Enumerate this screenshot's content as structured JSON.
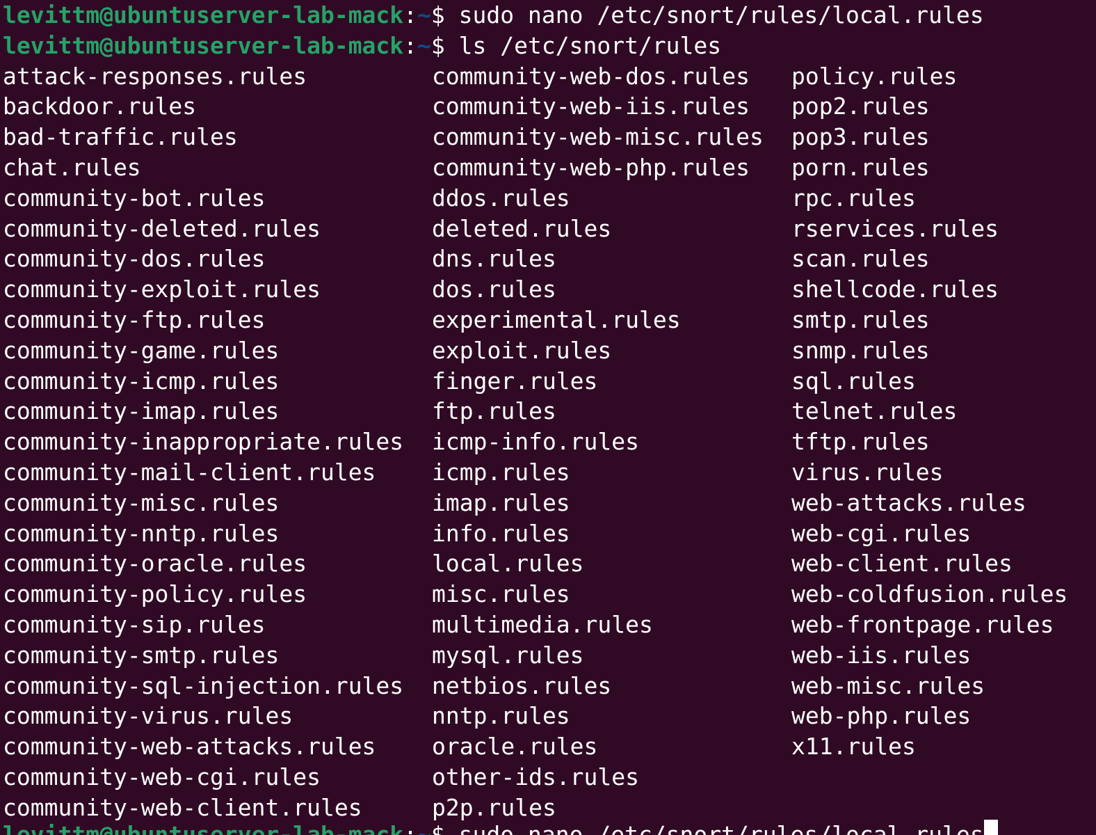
{
  "prompt": {
    "user_host": "levittm@ubuntuserver-lab-mack",
    "colon": ":",
    "path": "~",
    "dollar": "$ "
  },
  "history": [
    {
      "command": "sudo nano /etc/snort/rules/local.rules"
    },
    {
      "command": "ls /etc/snort/rules"
    }
  ],
  "listing": {
    "col1": [
      "attack-responses.rules",
      "backdoor.rules",
      "bad-traffic.rules",
      "chat.rules",
      "community-bot.rules",
      "community-deleted.rules",
      "community-dos.rules",
      "community-exploit.rules",
      "community-ftp.rules",
      "community-game.rules",
      "community-icmp.rules",
      "community-imap.rules",
      "community-inappropriate.rules",
      "community-mail-client.rules",
      "community-misc.rules",
      "community-nntp.rules",
      "community-oracle.rules",
      "community-policy.rules",
      "community-sip.rules",
      "community-smtp.rules",
      "community-sql-injection.rules",
      "community-virus.rules",
      "community-web-attacks.rules",
      "community-web-cgi.rules",
      "community-web-client.rules"
    ],
    "col2": [
      "community-web-dos.rules",
      "community-web-iis.rules",
      "community-web-misc.rules",
      "community-web-php.rules",
      "ddos.rules",
      "deleted.rules",
      "dns.rules",
      "dos.rules",
      "experimental.rules",
      "exploit.rules",
      "finger.rules",
      "ftp.rules",
      "icmp-info.rules",
      "icmp.rules",
      "imap.rules",
      "info.rules",
      "local.rules",
      "misc.rules",
      "multimedia.rules",
      "mysql.rules",
      "netbios.rules",
      "nntp.rules",
      "oracle.rules",
      "other-ids.rules",
      "p2p.rules"
    ],
    "col3": [
      "policy.rules",
      "pop2.rules",
      "pop3.rules",
      "porn.rules",
      "rpc.rules",
      "rservices.rules",
      "scan.rules",
      "shellcode.rules",
      "smtp.rules",
      "snmp.rules",
      "sql.rules",
      "telnet.rules",
      "tftp.rules",
      "virus.rules",
      "web-attacks.rules",
      "web-cgi.rules",
      "web-client.rules",
      "web-coldfusion.rules",
      "web-frontpage.rules",
      "web-iis.rules",
      "web-misc.rules",
      "web-php.rules",
      "x11.rules"
    ]
  },
  "current_line": {
    "command": "sudo nano /etc/snort/rules/local.rules"
  }
}
